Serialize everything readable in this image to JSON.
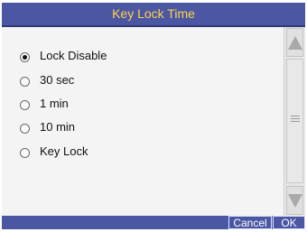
{
  "dialog": {
    "title": "Key Lock Time",
    "options": [
      {
        "label": "Lock Disable",
        "selected": true
      },
      {
        "label": "30 sec",
        "selected": false
      },
      {
        "label": "1 min",
        "selected": false
      },
      {
        "label": "10 min",
        "selected": false
      },
      {
        "label": "Key Lock",
        "selected": false
      }
    ],
    "cancel_label": "Cancel",
    "ok_label": "OK"
  },
  "colors": {
    "title_bar": "#4b57a3",
    "title_text": "#ffd24a",
    "background": "#f2f2f2"
  },
  "icons": {
    "scroll_up": "up-arrow-icon",
    "scroll_down": "down-arrow-icon",
    "scroll_grip": "grip-icon"
  }
}
